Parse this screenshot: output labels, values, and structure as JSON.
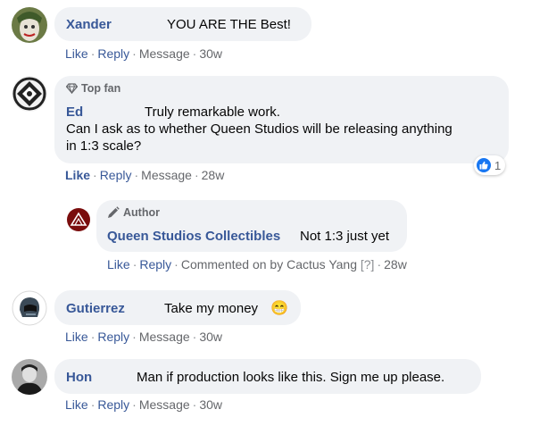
{
  "comments": [
    {
      "author": "Xander",
      "text": "YOU ARE THE Best!",
      "actions": {
        "like": "Like",
        "reply": "Reply",
        "message": "Message",
        "time": "30w"
      }
    },
    {
      "badge": "Top fan",
      "author": "Ed",
      "text_line1": "Truly remarkable work.",
      "text_line2": "Can I ask as to whether Queen Studios will be releasing anything",
      "text_line3": "in 1:3 scale?",
      "actions": {
        "like": "Like",
        "reply": "Reply",
        "message": "Message",
        "time": "28w"
      },
      "reaction_count": "1"
    },
    {
      "badge": "Author",
      "author": "Queen Studios Collectibles",
      "text": "Not 1:3 just yet",
      "actions": {
        "like": "Like",
        "reply": "Reply",
        "commented_on_by": "Commented on by Cactus Yang",
        "help": "[?]",
        "time": "28w"
      }
    },
    {
      "author": "Gutierrez",
      "text": "Take my money",
      "emoji": "😁",
      "actions": {
        "like": "Like",
        "reply": "Reply",
        "message": "Message",
        "time": "30w"
      }
    },
    {
      "author": "Hon",
      "text": "Man if production looks like this. Sign me up please.",
      "actions": {
        "like": "Like",
        "reply": "Reply",
        "message": "Message",
        "time": "30w"
      }
    }
  ],
  "colors": {
    "link": "#385898",
    "bubble": "#f0f2f5",
    "meta": "#65676b",
    "like_blue": "#1877f2"
  },
  "icons": [
    "diamond-icon",
    "pencil-icon",
    "like-thumb-icon"
  ]
}
